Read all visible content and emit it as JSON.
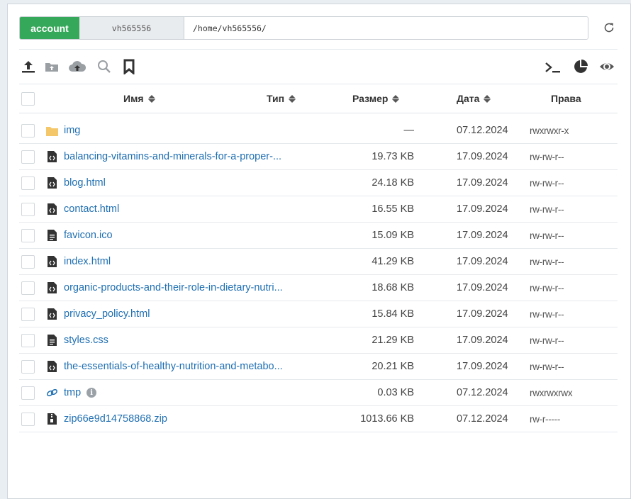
{
  "pathbar": {
    "account_label": "account",
    "user_label": "vh565556",
    "path_value": "/home/vh565556/"
  },
  "toolbar": {
    "left": [
      "upload-icon",
      "upload-folder-icon",
      "cloud-upload-icon",
      "search-icon",
      "bookmark-icon"
    ],
    "right": [
      "terminal-icon",
      "disk-usage-icon",
      "eye-icon"
    ]
  },
  "table": {
    "columns": {
      "name": "Имя",
      "type": "Тип",
      "size": "Размер",
      "date": "Дата",
      "perms": "Права"
    },
    "rows": [
      {
        "icon": "folder-icon",
        "name": "img",
        "size": "—",
        "date": "07.12.2024",
        "perms": "rwxrwxr-x"
      },
      {
        "icon": "code-file-icon",
        "name": "balancing-vitamins-and-minerals-for-a-proper-...",
        "size": "19.73 KB",
        "date": "17.09.2024",
        "perms": "rw-rw-r--"
      },
      {
        "icon": "code-file-icon",
        "name": "blog.html",
        "size": "24.18 KB",
        "date": "17.09.2024",
        "perms": "rw-rw-r--"
      },
      {
        "icon": "code-file-icon",
        "name": "contact.html",
        "size": "16.55 KB",
        "date": "17.09.2024",
        "perms": "rw-rw-r--"
      },
      {
        "icon": "text-file-icon",
        "name": "favicon.ico",
        "size": "15.09 KB",
        "date": "17.09.2024",
        "perms": "rw-rw-r--"
      },
      {
        "icon": "code-file-icon",
        "name": "index.html",
        "size": "41.29 KB",
        "date": "17.09.2024",
        "perms": "rw-rw-r--"
      },
      {
        "icon": "code-file-icon",
        "name": "organic-products-and-their-role-in-dietary-nutri...",
        "size": "18.68 KB",
        "date": "17.09.2024",
        "perms": "rw-rw-r--"
      },
      {
        "icon": "code-file-icon",
        "name": "privacy_policy.html",
        "size": "15.84 KB",
        "date": "17.09.2024",
        "perms": "rw-rw-r--"
      },
      {
        "icon": "text-file-icon",
        "name": "styles.css",
        "size": "21.29 KB",
        "date": "17.09.2024",
        "perms": "rw-rw-r--"
      },
      {
        "icon": "code-file-icon",
        "name": "the-essentials-of-healthy-nutrition-and-metabo...",
        "size": "20.21 KB",
        "date": "17.09.2024",
        "perms": "rw-rw-r--"
      },
      {
        "icon": "link-icon",
        "name": "tmp",
        "info": "i",
        "size": "0.03 KB",
        "date": "07.12.2024",
        "perms": "rwxrwxrwx"
      },
      {
        "icon": "archive-file-icon",
        "name": "zip66e9d14758868.zip",
        "size": "1013.66 KB",
        "date": "07.12.2024",
        "perms": "rw-r-----"
      }
    ]
  },
  "colors": {
    "account_badge": "#36a85a",
    "link": "#1f6fb2",
    "folder": "#f5c76b",
    "icon_dark": "#333333"
  }
}
